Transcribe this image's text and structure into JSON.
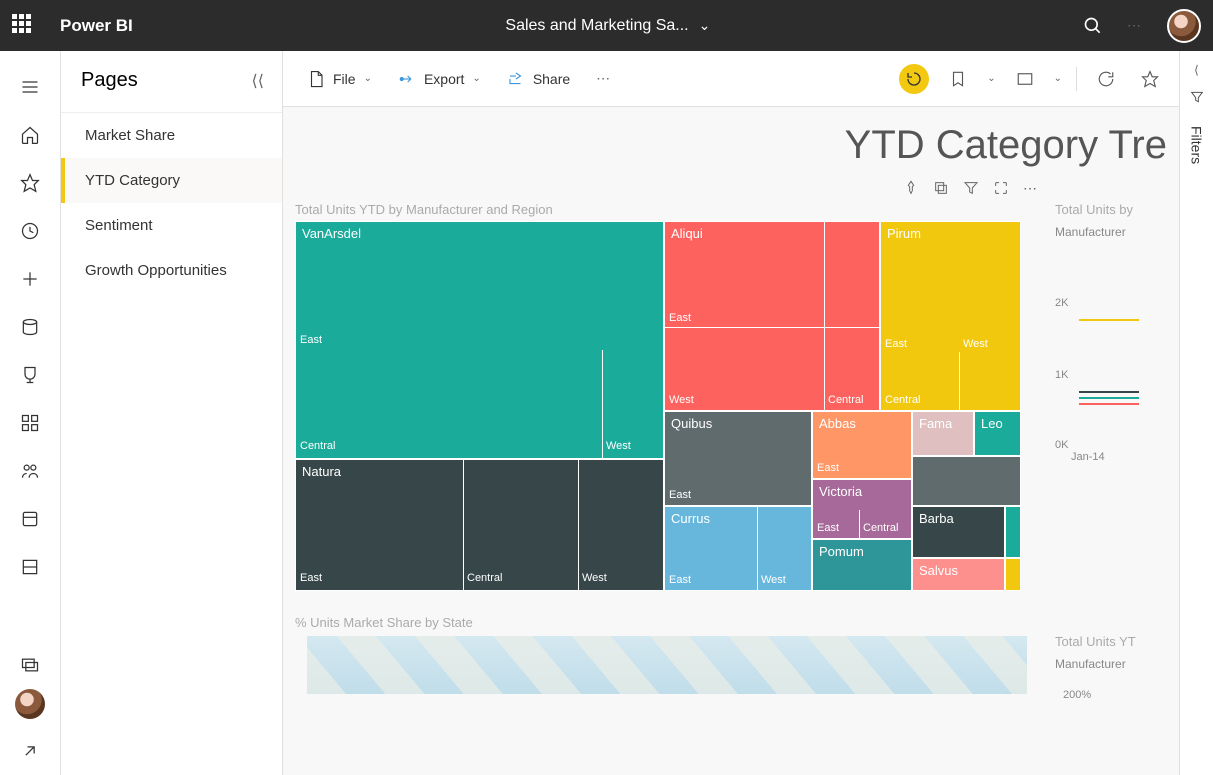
{
  "brand": "Power BI",
  "workspace_title": "Sales and Marketing Sa...",
  "toolbar": {
    "file": "File",
    "export": "Export",
    "share": "Share"
  },
  "pages_panel": {
    "title": "Pages",
    "items": [
      "Market Share",
      "YTD Category",
      "Sentiment",
      "Growth Opportunities"
    ],
    "active_index": 1
  },
  "report": {
    "title": "YTD Category Tre",
    "treemap_title": "Total Units YTD by Manufacturer and Region",
    "side_chart_title": "Total Units by",
    "side_sub": "Manufacturer",
    "map_title": "% Units Market Share by State",
    "side2_title": "Total Units YT",
    "side2_sub": "Manufacturer",
    "side2_value": "200%",
    "axis_x": "Jan-14",
    "axis_2k": "2K",
    "axis_1k": "1K",
    "axis_0k": "0K"
  },
  "filters_label": "Filters",
  "chart_data": {
    "type": "treemap",
    "title": "Total Units YTD by Manufacturer and Region",
    "manufacturers": [
      {
        "name": "VanArsdel",
        "color": "#1aab9b",
        "regions": [
          "East",
          "Central",
          "West"
        ],
        "approx_share": 28
      },
      {
        "name": "Natura",
        "color": "#374649",
        "regions": [
          "East",
          "Central",
          "West"
        ],
        "approx_share": 14
      },
      {
        "name": "Aliqui",
        "color": "#fd625e",
        "regions": [
          "East",
          "West",
          "Central"
        ],
        "approx_share": 14
      },
      {
        "name": "Pirum",
        "color": "#f2c80f",
        "regions": [
          "East",
          "West",
          "Central"
        ],
        "approx_share": 10
      },
      {
        "name": "Quibus",
        "color": "#5f6b6d",
        "regions": [
          "East"
        ],
        "approx_share": 5
      },
      {
        "name": "Abbas",
        "color": "#ff9666",
        "regions": [
          "East"
        ],
        "approx_share": 3
      },
      {
        "name": "Fama",
        "color": "#dfbfbf",
        "regions": [],
        "approx_share": 2
      },
      {
        "name": "Leo",
        "color": "#1aab9b",
        "regions": [],
        "approx_share": 1.5
      },
      {
        "name": "Currus",
        "color": "#67b7dc",
        "regions": [
          "East",
          "West"
        ],
        "approx_share": 5
      },
      {
        "name": "Victoria",
        "color": "#a66999",
        "regions": [
          "East",
          "Central"
        ],
        "approx_share": 3
      },
      {
        "name": "Barba",
        "color": "#374649",
        "regions": [],
        "approx_share": 3
      },
      {
        "name": "Pomum",
        "color": "#2e9599",
        "regions": [],
        "approx_share": 3
      },
      {
        "name": "Salvus",
        "color": "#fd8f8d",
        "regions": [],
        "approx_share": 2.5
      }
    ]
  }
}
